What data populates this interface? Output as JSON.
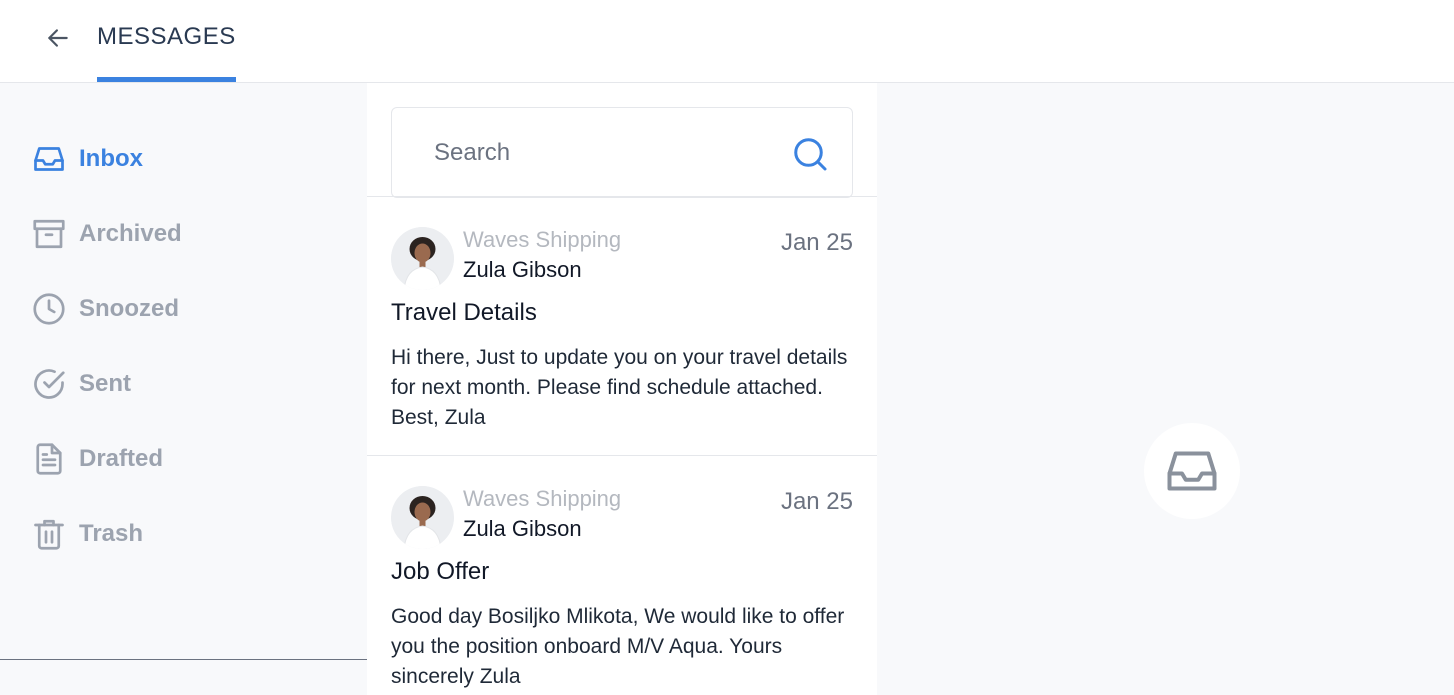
{
  "header": {
    "title": "MESSAGES",
    "back_icon": "arrow-left-icon"
  },
  "accent_color": "#3b82e0",
  "sidebar": {
    "items": [
      {
        "label": "Inbox",
        "icon": "inbox-icon",
        "active": true
      },
      {
        "label": "Archived",
        "icon": "archive-icon",
        "active": false
      },
      {
        "label": "Snoozed",
        "icon": "clock-icon",
        "active": false
      },
      {
        "label": "Sent",
        "icon": "check-circle-icon",
        "active": false
      },
      {
        "label": "Drafted",
        "icon": "document-icon",
        "active": false
      },
      {
        "label": "Trash",
        "icon": "trash-icon",
        "active": false
      }
    ]
  },
  "search": {
    "placeholder": "Search",
    "icon": "search-icon"
  },
  "messages": [
    {
      "company": "Waves Shipping",
      "sender": "Zula Gibson",
      "date": "Jan 25",
      "subject": "Travel Details",
      "preview": "Hi there, Just to update you on your travel details for next month. Please find schedule attached. Best, Zula"
    },
    {
      "company": "Waves Shipping",
      "sender": "Zula Gibson",
      "date": "Jan 25",
      "subject": "Job Offer",
      "preview": "Good day Bosiljko Mlikota, We would like to offer you the position onboard M/V Aqua. Yours sincerely Zula"
    }
  ],
  "detail": {
    "empty_icon": "inbox-icon"
  }
}
